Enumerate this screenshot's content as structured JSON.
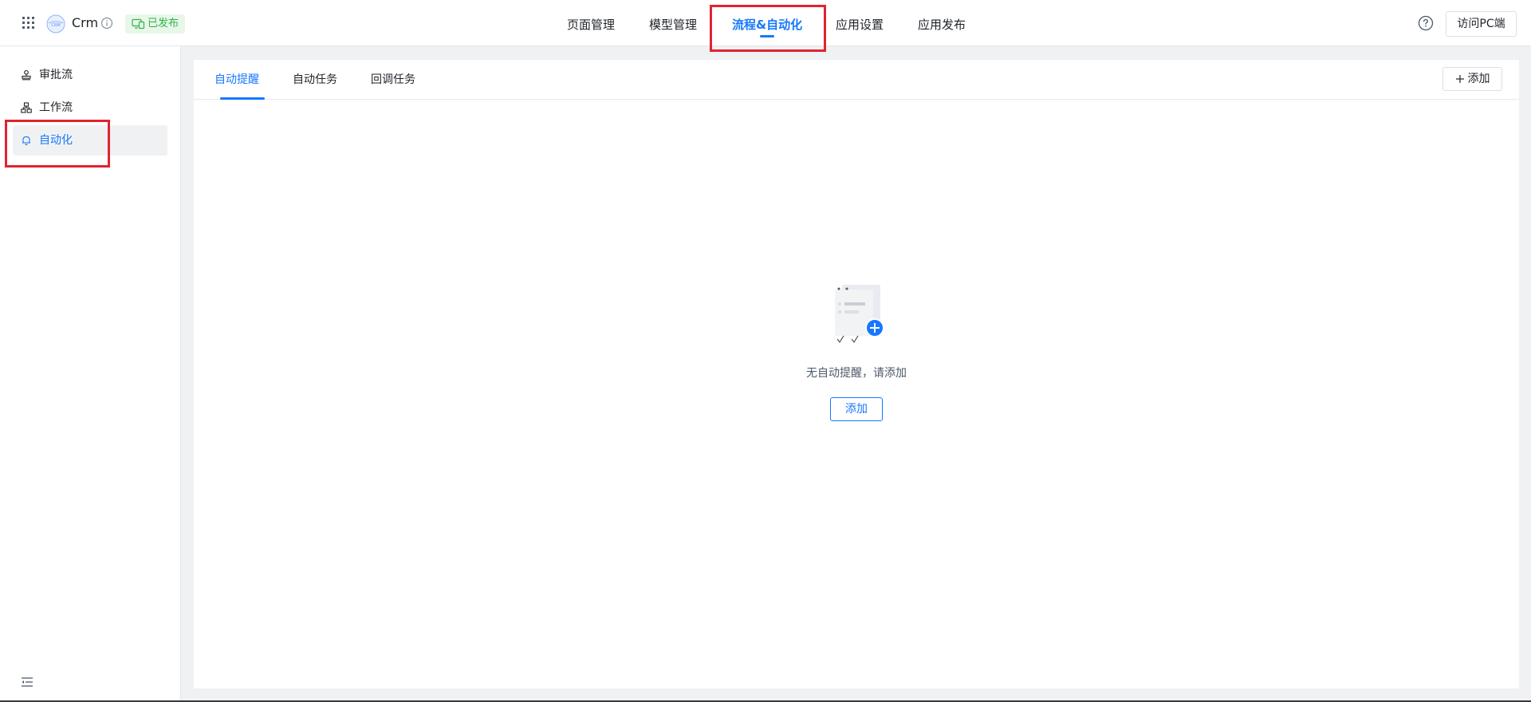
{
  "header": {
    "app_name": "Crm",
    "app_logo_text": "CRM",
    "status_badge": "已发布",
    "nav": [
      {
        "label": "页面管理",
        "active": false
      },
      {
        "label": "模型管理",
        "active": false
      },
      {
        "label": "流程&自动化",
        "active": true
      },
      {
        "label": "应用设置",
        "active": false
      },
      {
        "label": "应用发布",
        "active": false
      }
    ],
    "visit_pc_label": "访问PC端"
  },
  "sidebar": {
    "items": [
      {
        "label": "审批流",
        "icon": "stamp-icon",
        "active": false
      },
      {
        "label": "工作流",
        "icon": "workflow-icon",
        "active": false
      },
      {
        "label": "自动化",
        "icon": "bell-icon",
        "active": true
      }
    ]
  },
  "main": {
    "tabs": [
      {
        "label": "自动提醒",
        "active": true
      },
      {
        "label": "自动任务",
        "active": false
      },
      {
        "label": "回调任务",
        "active": false
      }
    ],
    "add_label": "添加",
    "empty_text": "无自动提醒，请添加",
    "empty_add_label": "添加"
  },
  "colors": {
    "accent": "#1677ff",
    "highlight": "#e0242f",
    "published_green": "#30b348"
  }
}
